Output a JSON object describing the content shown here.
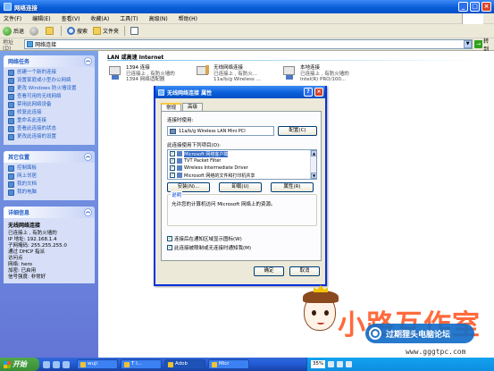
{
  "window": {
    "title": "网络连接",
    "buttons": [
      "_",
      "□",
      "×"
    ]
  },
  "menubar": [
    "文件(F)",
    "编辑(E)",
    "查看(V)",
    "收藏(A)",
    "工具(T)",
    "高级(N)",
    "帮助(H)"
  ],
  "toolbar": {
    "back_label": "后退",
    "search_label": "搜索",
    "folders_label": "文件夹"
  },
  "addressbar": {
    "label": "地址(D)",
    "value": "网络连接",
    "go_label": "转到"
  },
  "leftpane": {
    "network_tasks": {
      "title": "网络任务",
      "items": [
        "创建一个新的连接",
        "设置家庭或小型办公网络",
        "更改 Windows 防火墙设置",
        "查看可用的无线网络",
        "禁用此网络设备",
        "修复此连接",
        "重命名此连接",
        "查看此连接的状态",
        "更改此连接的设置"
      ]
    },
    "other_places": {
      "title": "其它位置",
      "items": [
        "控制面板",
        "网上邻居",
        "我的文档",
        "我的电脑"
      ]
    },
    "details": {
      "title": "详细信息",
      "name": "无线网络连接",
      "lines": [
        "已连接上 , 有防火墙的",
        "IP 地址: 192.168.1.4",
        "子网掩码: 255.255.255.0",
        "通过 DHCP 指派",
        "访问点",
        "网络: hero",
        "加密: 已启用",
        "信号强度: 非常好"
      ]
    }
  },
  "content": {
    "group_heading": "LAN 或高速 Internet",
    "connections": [
      {
        "name": "1394 连接",
        "status": "已连接上 , 有防火墙的",
        "device": "1394 网络适配器"
      },
      {
        "name": "无线网络连接",
        "status": "已连接上 , 有防火...",
        "device": "11a/b/g Wireless ..."
      },
      {
        "name": "本地连接",
        "status": "已连接上 , 有防火墙的",
        "device": "Intel(R) PRO/100..."
      }
    ]
  },
  "dialog": {
    "title": "无线网络连接 属性",
    "tabs": [
      "常规",
      "高级"
    ],
    "connect_using_label": "连接时使用:",
    "adapter_name": "11a/b/g Wireless LAN Mini PCI",
    "configure_label": "配置(C)",
    "items_label": "此连接使用下列项目(O):",
    "items": [
      {
        "label": "Microsoft 网络客户端",
        "checked": true,
        "selected": true
      },
      {
        "label": "TVT Packet Filter",
        "checked": true,
        "selected": false
      },
      {
        "label": "Wireless Intermediate Driver",
        "checked": true,
        "selected": false
      },
      {
        "label": "Microsoft 网络的文件和打印机共享",
        "checked": true,
        "selected": false
      }
    ],
    "install_label": "安装(N)...",
    "uninstall_label": "卸载(U)",
    "properties_label": "属性(R)",
    "description_legend": "说明",
    "description_text": "允许您的计算机访问 Microsoft 网络上的资源。",
    "checkbox1_label": "连接后在通知区域显示图标(W)",
    "checkbox2_label": "此连接被限制或无连接时通知我(M)",
    "ok_label": "确定",
    "cancel_label": "取消"
  },
  "watermark": {
    "brand_text": "小路互作室",
    "overlay_text": "过期狸头电脑论坛",
    "site": "www.gggtpc.com"
  },
  "taskbar": {
    "start_label": "开始",
    "tasks": [
      "wuji",
      "T I...",
      "Adob",
      "Micr"
    ],
    "ime": "35%"
  }
}
